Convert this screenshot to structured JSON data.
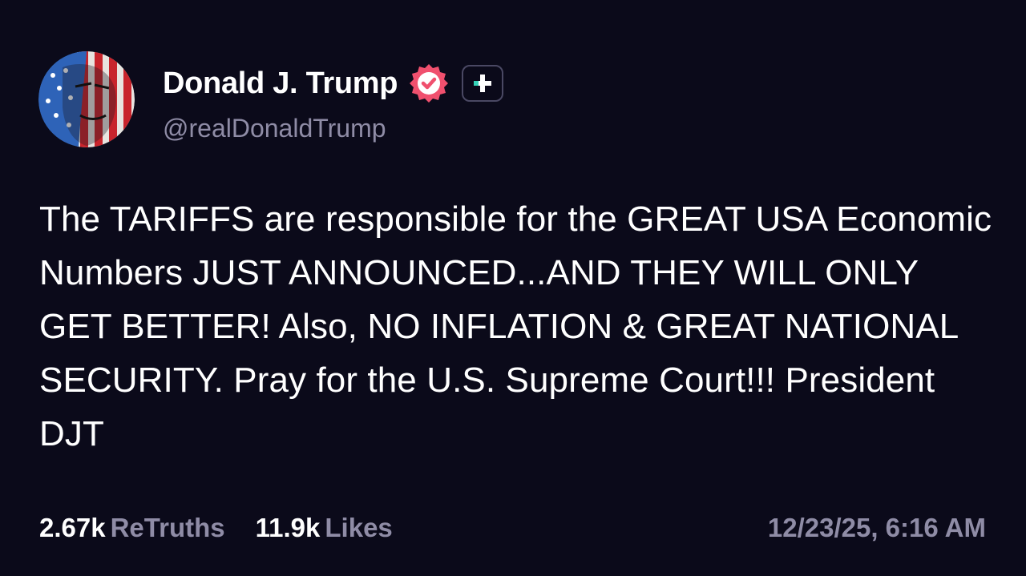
{
  "post": {
    "author": {
      "display_name": "Donald J. Trump",
      "handle": "@realDonaldTrump",
      "verified_icon": "verified-badge-icon",
      "follow_icon": "plus-icon",
      "colors": {
        "verified_badge": "#f0506e",
        "follow_plus_accent": "#35d3b8"
      }
    },
    "text": "The TARIFFS are responsible for the GREAT USA Economic Numbers JUST ANNOUNCED...AND THEY WILL ONLY GET BETTER! Also, NO INFLATION & GREAT NATIONAL SECURITY. Pray for the U.S. Supreme Court!!! President DJT",
    "stats": {
      "retruths_count": "2.67k",
      "retruths_label": "ReTruths",
      "likes_count": "11.9k",
      "likes_label": "Likes"
    },
    "timestamp": "12/23/25, 6:16 AM"
  },
  "theme": {
    "background": "#0b0a1a",
    "text_primary": "#ffffff",
    "text_secondary": "#8f8ca6"
  }
}
